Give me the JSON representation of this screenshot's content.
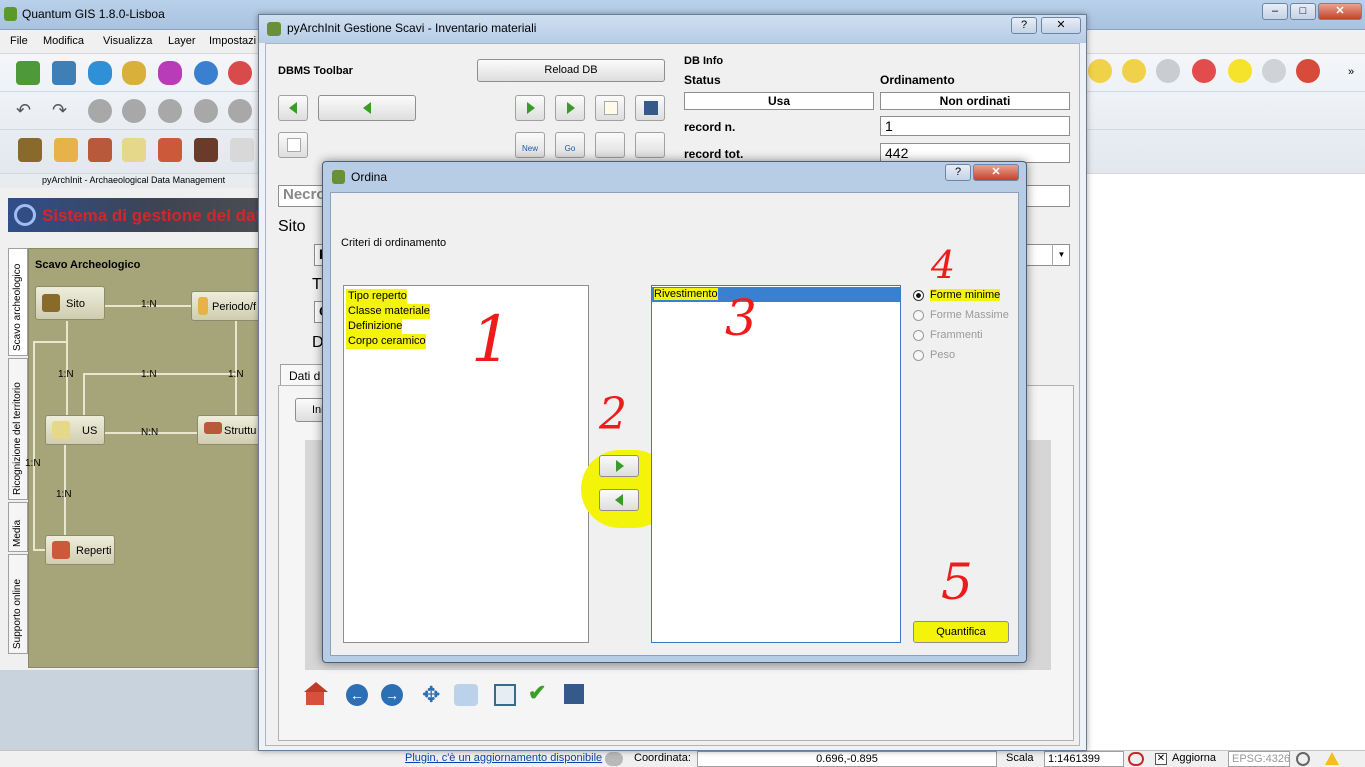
{
  "qgis": {
    "title": "Quantum GIS 1.8.0-Lisboa",
    "menu": [
      "File",
      "Modifica",
      "Visualizza",
      "Layer",
      "Impostazi"
    ],
    "plugin_toolbar_label": "pyArchInit - Archaeological Data Management",
    "banner_text": "Sistema di gestione del data",
    "vertical_tabs": [
      "Scavo archeologico",
      "Ricognizione del territorio",
      "Media",
      "Supporto online"
    ],
    "diagram": {
      "header": "Scavo Archeologico",
      "nodes": {
        "sito": "Sito",
        "periodo": "Periodo/f",
        "us": "US",
        "strutture": "Struttu",
        "reperti": "Reperti"
      },
      "relations": {
        "sito_periodo": "1:N",
        "sito_us": "1:N",
        "us_periodo": "1:N",
        "periodo_strut": "1:N",
        "us_strut": "N:N",
        "left_1n": "1:N",
        "us_reperti": "1:N"
      }
    },
    "status": {
      "plugin_update": "Plugin, c'è un aggiornamento disponibile",
      "coordinate_label": "Coordinata:",
      "coordinate_value": "0.696,-0.895",
      "scale_label": "Scala",
      "scale_value": "1:1461399",
      "refresh_label": "Aggiorna",
      "epsg": "EPSG:4326"
    }
  },
  "pyarch": {
    "title": "pyArchInit Gestione Scavi - Inventario materiali",
    "dbms_toolbar": "DBMS Toolbar",
    "reload_db": "Reload DB",
    "new_label": "New",
    "go_label": "Go",
    "db_info": {
      "header": "DB Info",
      "status_label": "Status",
      "ordering_label": "Ordinamento",
      "status_value": "Usa",
      "ordering_value": "Non ordinati",
      "record_n_label": "record n.",
      "record_n_value": "1",
      "record_tot_label": "record tot.",
      "record_tot_value": "442"
    },
    "partial_field": "Necro",
    "sito_label": "Sito",
    "partial_row_1": "P",
    "partial_row_2": "T",
    "partial_row_3": "C",
    "partial_row_4": "D",
    "tab_label": "Dati d",
    "inner_button": "Ini"
  },
  "ordina": {
    "title": "Ordina",
    "criteria_label": "Criteri di ordinamento",
    "available_fields": [
      "Tipo reperto",
      "Classe materiale",
      "Definizione",
      "Corpo ceramico"
    ],
    "selected_fields": [
      "Rivestimento"
    ],
    "radio_options": [
      {
        "label": "Forme minime",
        "checked": true
      },
      {
        "label": "Forme Massime",
        "checked": false
      },
      {
        "label": "Frammenti",
        "checked": false
      },
      {
        "label": "Peso",
        "checked": false
      }
    ],
    "quantify_button": "Quantifica",
    "annotations": [
      "1",
      "2",
      "3",
      "4",
      "5"
    ]
  }
}
